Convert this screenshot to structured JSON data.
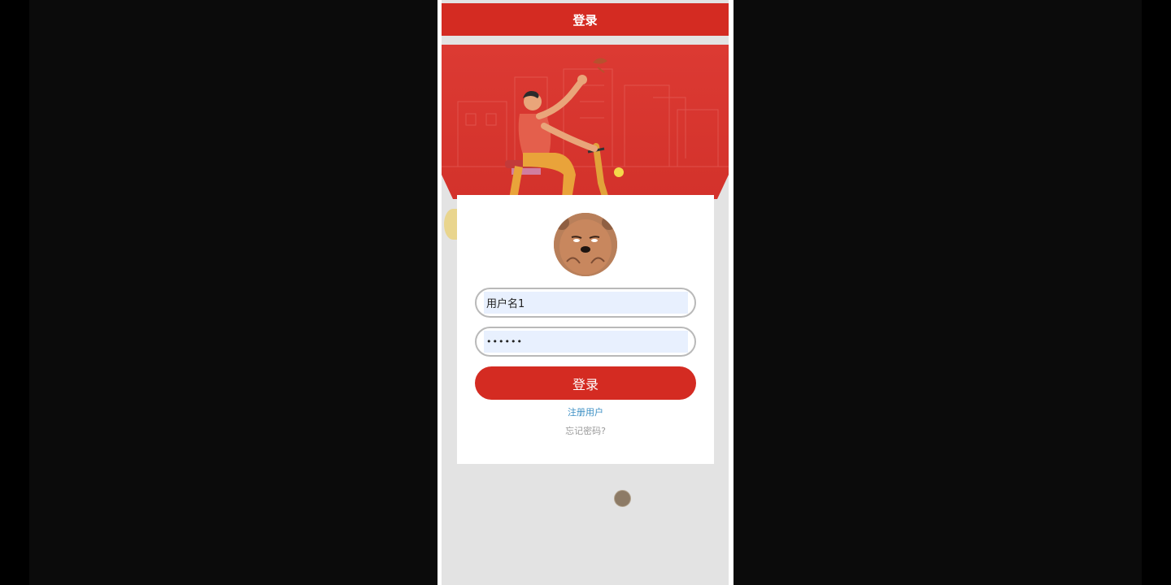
{
  "header": {
    "title": "登录"
  },
  "form": {
    "username_value": "用户名1",
    "password_mask": "••••••",
    "login_label": "登录",
    "register_label": "注册用户",
    "forgot_label": "忘记密码?"
  },
  "colors": {
    "brand_red": "#d42b22",
    "link_blue": "#3b8fc4",
    "muted_gray": "#9a9a9a",
    "input_fill": "#e8f0fe",
    "screen_bg": "#e3e3e3"
  },
  "icons": {
    "avatar": "bear-avatar-icon",
    "banner": "cyclist-illustration",
    "scroll_indicator": "floating-dot-icon"
  }
}
